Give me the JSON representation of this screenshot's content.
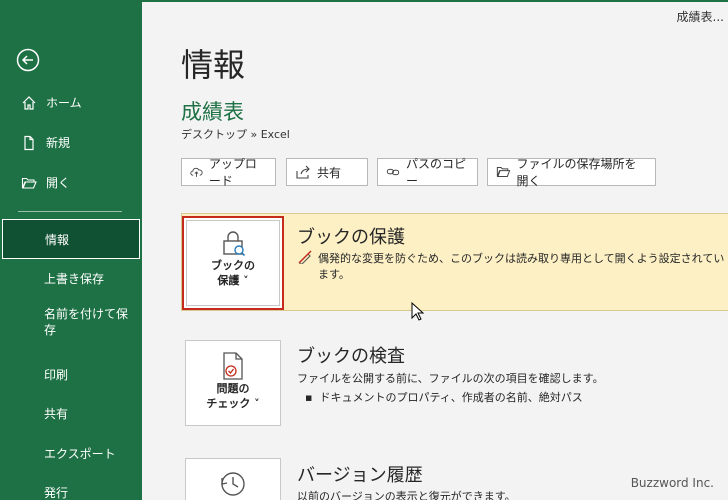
{
  "window": {
    "title_fragment": "成績表..."
  },
  "sidebar": {
    "items": [
      {
        "label": "ホーム",
        "icon": "home-icon"
      },
      {
        "label": "新規",
        "icon": "new-document-icon"
      },
      {
        "label": "開く",
        "icon": "folder-open-icon"
      },
      {
        "label": "情報",
        "active": true
      },
      {
        "label": "上書き保存"
      },
      {
        "label": "名前を付けて保存"
      },
      {
        "label": "印刷"
      },
      {
        "label": "共有"
      },
      {
        "label": "エクスポート"
      },
      {
        "label": "発行"
      }
    ]
  },
  "main": {
    "title": "情報",
    "doc_name": "成績表",
    "doc_path": "デスクトップ » Excel",
    "actions": [
      {
        "label": "アップロード",
        "icon": "cloud-upload-icon"
      },
      {
        "label": "共有",
        "icon": "share-icon"
      },
      {
        "label": "パスのコピー",
        "icon": "link-icon"
      },
      {
        "label": "ファイルの保存場所を開く",
        "icon": "folder-icon"
      }
    ],
    "protect": {
      "button_line1": "ブックの",
      "button_line2": "保護 ˅",
      "title": "ブックの保護",
      "description": "偶発的な変更を防ぐため、このブックは読み取り専用として開くよう設定されています。"
    },
    "inspect": {
      "button_line1": "問題の",
      "button_line2": "チェック ˅",
      "title": "ブックの検査",
      "description": "ファイルを公開する前に、ファイルの次の項目を確認します。",
      "bullet": "ドキュメントのプロパティ、作成者の名前、絶対パス"
    },
    "version": {
      "title": "バージョン履歴",
      "description": "以前のバージョンの表示と復元ができます。"
    }
  },
  "watermark": "Buzzword Inc.",
  "colors": {
    "sidebar": "#1e7145",
    "active": "#0f5132",
    "panel": "#fdf0c5",
    "highlight": "#c42b1c"
  }
}
